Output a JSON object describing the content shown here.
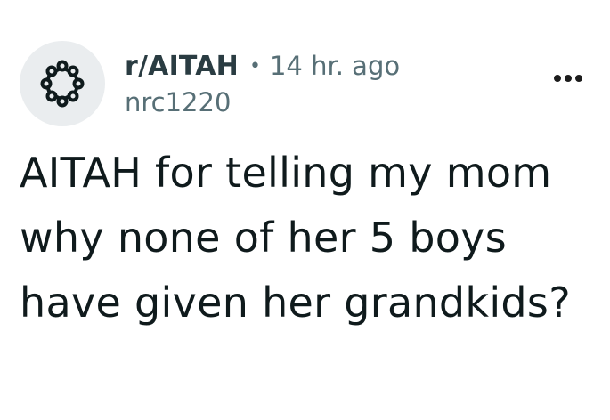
{
  "post": {
    "subreddit": "r/AITAH",
    "separator": "•",
    "time_ago": "14 hr. ago",
    "author": "nrc1220",
    "title": "AITAH for telling my mom why none of her 5 boys have given her grandkids?"
  },
  "icons": {
    "avatar": "subreddit-ring-icon",
    "overflow": "more-options-icon"
  },
  "colors": {
    "avatar_bg": "#eaedef",
    "meta_text": "#576f76",
    "title_text": "#0f1a1c"
  }
}
